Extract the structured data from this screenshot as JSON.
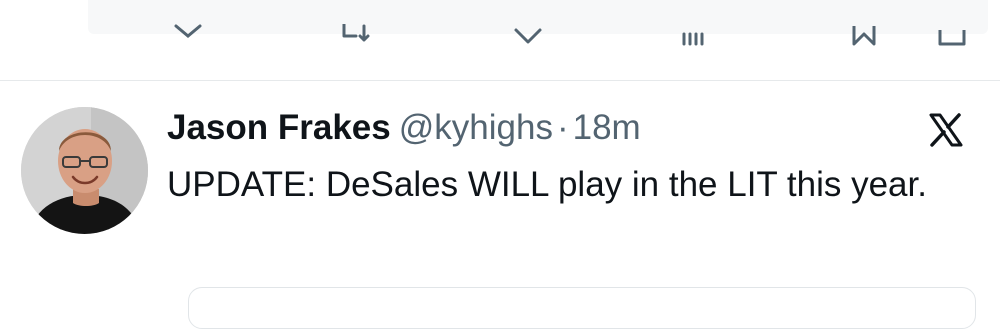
{
  "icons": {
    "reply": "reply-icon",
    "retweet": "retweet-icon",
    "like": "heart-icon",
    "views": "views-icon",
    "bookmark": "bookmark-icon",
    "share": "share-icon",
    "platform": "x-logo-icon"
  },
  "tweet": {
    "author_name": "Jason Frakes",
    "handle": "@kyhighs",
    "separator": "·",
    "time_ago": "18m",
    "text": "UPDATE: DeSales WILL play in the LIT this year."
  },
  "colors": {
    "text_primary": "#0f1419",
    "text_secondary": "#536471",
    "divider": "#e6e9eb",
    "background": "#ffffff"
  }
}
